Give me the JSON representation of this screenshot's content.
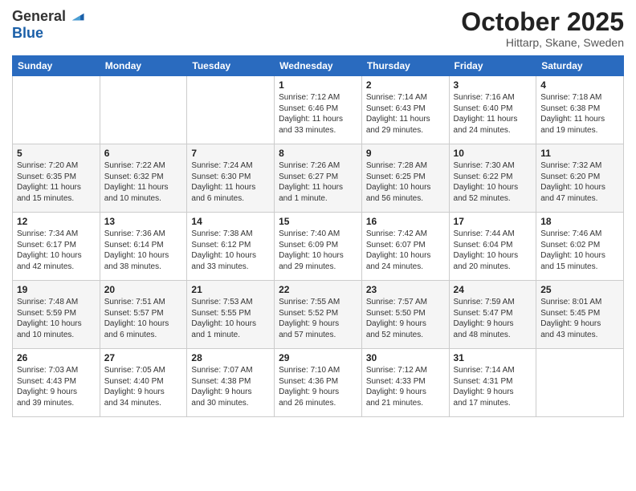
{
  "logo": {
    "general": "General",
    "blue": "Blue"
  },
  "header": {
    "month": "October 2025",
    "location": "Hittarp, Skane, Sweden"
  },
  "weekdays": [
    "Sunday",
    "Monday",
    "Tuesday",
    "Wednesday",
    "Thursday",
    "Friday",
    "Saturday"
  ],
  "weeks": [
    [
      {
        "day": "",
        "info": ""
      },
      {
        "day": "",
        "info": ""
      },
      {
        "day": "",
        "info": ""
      },
      {
        "day": "1",
        "info": "Sunrise: 7:12 AM\nSunset: 6:46 PM\nDaylight: 11 hours\nand 33 minutes."
      },
      {
        "day": "2",
        "info": "Sunrise: 7:14 AM\nSunset: 6:43 PM\nDaylight: 11 hours\nand 29 minutes."
      },
      {
        "day": "3",
        "info": "Sunrise: 7:16 AM\nSunset: 6:40 PM\nDaylight: 11 hours\nand 24 minutes."
      },
      {
        "day": "4",
        "info": "Sunrise: 7:18 AM\nSunset: 6:38 PM\nDaylight: 11 hours\nand 19 minutes."
      }
    ],
    [
      {
        "day": "5",
        "info": "Sunrise: 7:20 AM\nSunset: 6:35 PM\nDaylight: 11 hours\nand 15 minutes."
      },
      {
        "day": "6",
        "info": "Sunrise: 7:22 AM\nSunset: 6:32 PM\nDaylight: 11 hours\nand 10 minutes."
      },
      {
        "day": "7",
        "info": "Sunrise: 7:24 AM\nSunset: 6:30 PM\nDaylight: 11 hours\nand 6 minutes."
      },
      {
        "day": "8",
        "info": "Sunrise: 7:26 AM\nSunset: 6:27 PM\nDaylight: 11 hours\nand 1 minute."
      },
      {
        "day": "9",
        "info": "Sunrise: 7:28 AM\nSunset: 6:25 PM\nDaylight: 10 hours\nand 56 minutes."
      },
      {
        "day": "10",
        "info": "Sunrise: 7:30 AM\nSunset: 6:22 PM\nDaylight: 10 hours\nand 52 minutes."
      },
      {
        "day": "11",
        "info": "Sunrise: 7:32 AM\nSunset: 6:20 PM\nDaylight: 10 hours\nand 47 minutes."
      }
    ],
    [
      {
        "day": "12",
        "info": "Sunrise: 7:34 AM\nSunset: 6:17 PM\nDaylight: 10 hours\nand 42 minutes."
      },
      {
        "day": "13",
        "info": "Sunrise: 7:36 AM\nSunset: 6:14 PM\nDaylight: 10 hours\nand 38 minutes."
      },
      {
        "day": "14",
        "info": "Sunrise: 7:38 AM\nSunset: 6:12 PM\nDaylight: 10 hours\nand 33 minutes."
      },
      {
        "day": "15",
        "info": "Sunrise: 7:40 AM\nSunset: 6:09 PM\nDaylight: 10 hours\nand 29 minutes."
      },
      {
        "day": "16",
        "info": "Sunrise: 7:42 AM\nSunset: 6:07 PM\nDaylight: 10 hours\nand 24 minutes."
      },
      {
        "day": "17",
        "info": "Sunrise: 7:44 AM\nSunset: 6:04 PM\nDaylight: 10 hours\nand 20 minutes."
      },
      {
        "day": "18",
        "info": "Sunrise: 7:46 AM\nSunset: 6:02 PM\nDaylight: 10 hours\nand 15 minutes."
      }
    ],
    [
      {
        "day": "19",
        "info": "Sunrise: 7:48 AM\nSunset: 5:59 PM\nDaylight: 10 hours\nand 10 minutes."
      },
      {
        "day": "20",
        "info": "Sunrise: 7:51 AM\nSunset: 5:57 PM\nDaylight: 10 hours\nand 6 minutes."
      },
      {
        "day": "21",
        "info": "Sunrise: 7:53 AM\nSunset: 5:55 PM\nDaylight: 10 hours\nand 1 minute."
      },
      {
        "day": "22",
        "info": "Sunrise: 7:55 AM\nSunset: 5:52 PM\nDaylight: 9 hours\nand 57 minutes."
      },
      {
        "day": "23",
        "info": "Sunrise: 7:57 AM\nSunset: 5:50 PM\nDaylight: 9 hours\nand 52 minutes."
      },
      {
        "day": "24",
        "info": "Sunrise: 7:59 AM\nSunset: 5:47 PM\nDaylight: 9 hours\nand 48 minutes."
      },
      {
        "day": "25",
        "info": "Sunrise: 8:01 AM\nSunset: 5:45 PM\nDaylight: 9 hours\nand 43 minutes."
      }
    ],
    [
      {
        "day": "26",
        "info": "Sunrise: 7:03 AM\nSunset: 4:43 PM\nDaylight: 9 hours\nand 39 minutes."
      },
      {
        "day": "27",
        "info": "Sunrise: 7:05 AM\nSunset: 4:40 PM\nDaylight: 9 hours\nand 34 minutes."
      },
      {
        "day": "28",
        "info": "Sunrise: 7:07 AM\nSunset: 4:38 PM\nDaylight: 9 hours\nand 30 minutes."
      },
      {
        "day": "29",
        "info": "Sunrise: 7:10 AM\nSunset: 4:36 PM\nDaylight: 9 hours\nand 26 minutes."
      },
      {
        "day": "30",
        "info": "Sunrise: 7:12 AM\nSunset: 4:33 PM\nDaylight: 9 hours\nand 21 minutes."
      },
      {
        "day": "31",
        "info": "Sunrise: 7:14 AM\nSunset: 4:31 PM\nDaylight: 9 hours\nand 17 minutes."
      },
      {
        "day": "",
        "info": ""
      }
    ]
  ]
}
